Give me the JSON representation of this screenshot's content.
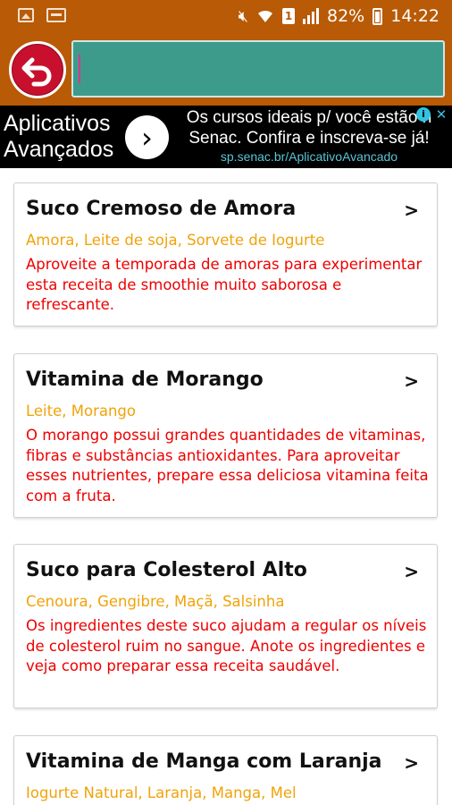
{
  "status_bar": {
    "battery_percent": "82%",
    "time": "14:22",
    "sim_slot": "1",
    "icons": [
      "image-icon",
      "voicemail-icon",
      "mute-icon",
      "wifi-icon",
      "sim-icon",
      "signal-icon",
      "battery-charging-icon"
    ]
  },
  "toolbar": {
    "back_icon": "back-arrow-icon",
    "search_value": "",
    "colors": {
      "bar": "#b85a06",
      "search_bg": "#3d9b8c",
      "back_button": "#c8102e"
    }
  },
  "ad": {
    "title_line1": "Aplicativos",
    "title_line2": "Avançados",
    "text_line1": "Os cursos ideais p/ você estão n",
    "text_line2": "Senac. Confira e inscreva-se já!",
    "url": "sp.senac.br/AplicativoAvancado",
    "arrow_glyph": "›",
    "info_glyph": "i",
    "close_glyph": "✕"
  },
  "recipes": [
    {
      "title": "Suco Cremoso de Amora",
      "ingredients": "Amora, Leite de soja, Sorvete de Iogurte",
      "description": "Aproveite a temporada de amoras para experimentar esta receita de smoothie muito saborosa e refrescante.",
      "chevron": ">"
    },
    {
      "title": "Vitamina de Morango",
      "ingredients": "Leite, Morango",
      "description": "O morango possui grandes quantidades de vitaminas, fibras e substâncias antioxidantes. Para aproveitar esses nutrientes, prepare essa deliciosa vitamina feita com a fruta.",
      "chevron": ">"
    },
    {
      "title": "Suco para Colesterol Alto",
      "ingredients": "Cenoura, Gengibre, Maçã, Salsinha",
      "description": "Os ingredientes deste suco ajudam a regular os níveis de colesterol ruim no sangue. Anote os ingredientes e veja como preparar essa receita saudável.",
      "chevron": ">"
    },
    {
      "title": "Vitamina de Manga com Laranja",
      "ingredients": "Iogurte Natural, Laranja, Manga, Mel",
      "description": "",
      "chevron": ">"
    }
  ],
  "colors": {
    "title": "#111111",
    "ingredients": "#f0a30a",
    "description": "#ee0000"
  }
}
